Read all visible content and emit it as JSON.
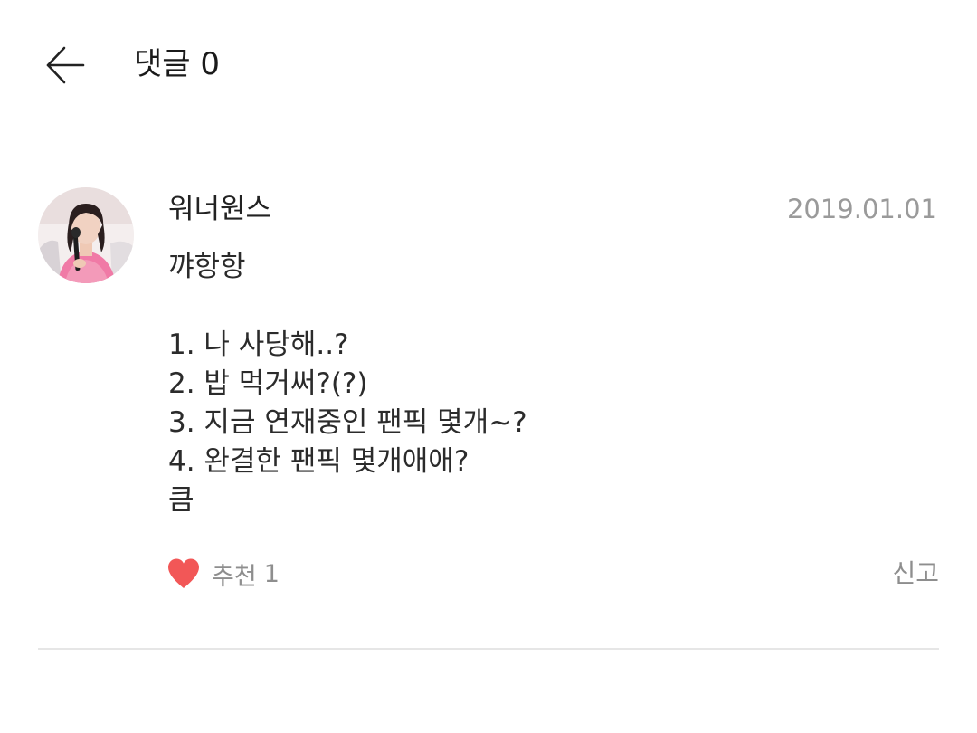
{
  "header": {
    "back_icon": "arrow-left-icon",
    "title": "댓글 0"
  },
  "comment": {
    "avatar_icon": "profile-photo",
    "username": "워너원스",
    "date": "2019.01.01",
    "lines": [
      "꺄항항",
      "",
      "1. 나 사당해..?",
      "2. 밥 먹거써?(?)",
      "3. 지금 연재중인 팬픽 몇개~?",
      "4. 완결한 팬픽 몇개애애?",
      "큼"
    ],
    "like": {
      "icon": "heart-icon",
      "color": "#f25757",
      "label": "추천",
      "count": "1"
    },
    "report_label": "신고"
  },
  "colors": {
    "text_primary": "#222222",
    "text_muted": "#8e8e8e",
    "date": "#9a9a9a",
    "divider": "#e6e6e6",
    "heart": "#f25757"
  }
}
